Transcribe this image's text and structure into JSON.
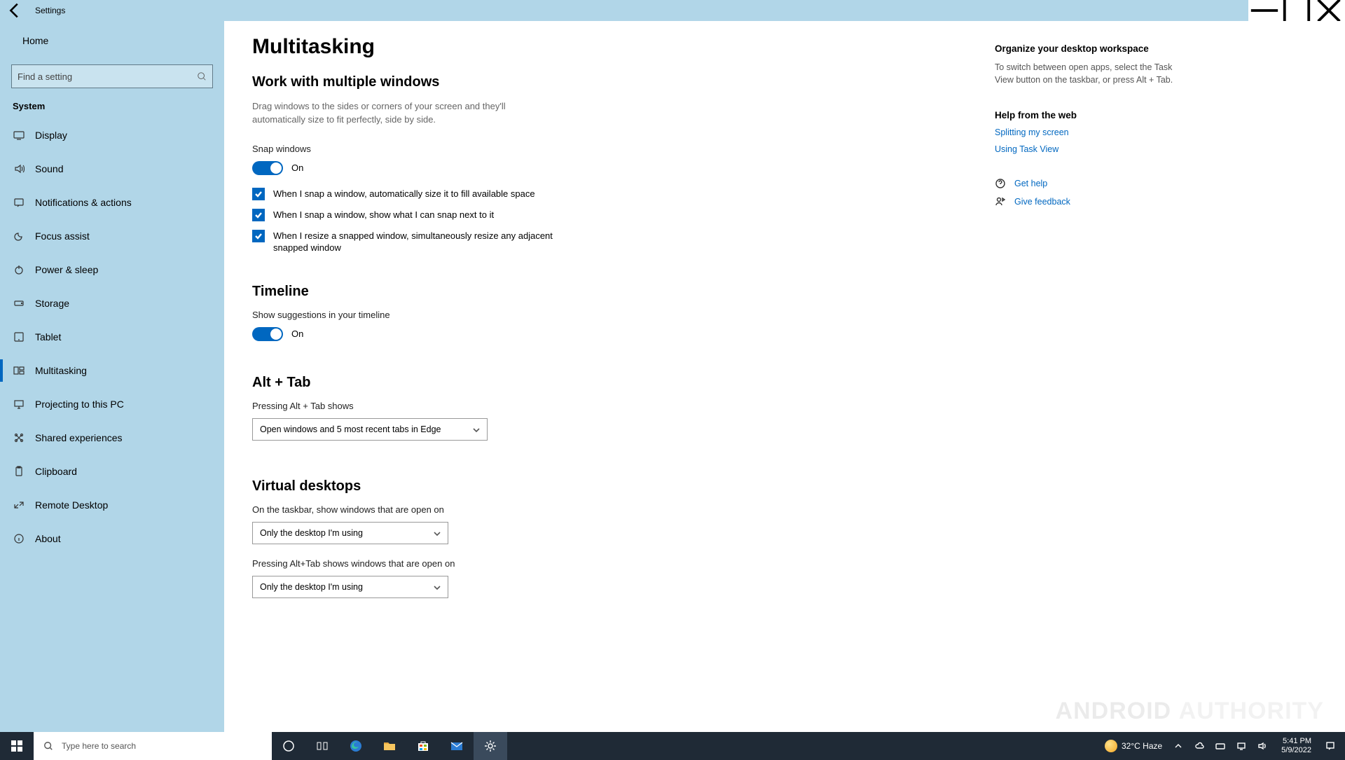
{
  "window": {
    "title": "Settings"
  },
  "sidebar": {
    "home": "Home",
    "search_placeholder": "Find a setting",
    "group": "System",
    "items": [
      {
        "label": "Display"
      },
      {
        "label": "Sound"
      },
      {
        "label": "Notifications & actions"
      },
      {
        "label": "Focus assist"
      },
      {
        "label": "Power & sleep"
      },
      {
        "label": "Storage"
      },
      {
        "label": "Tablet"
      },
      {
        "label": "Multitasking"
      },
      {
        "label": "Projecting to this PC"
      },
      {
        "label": "Shared experiences"
      },
      {
        "label": "Clipboard"
      },
      {
        "label": "Remote Desktop"
      },
      {
        "label": "About"
      }
    ]
  },
  "page": {
    "title": "Multitasking",
    "sec1_title": "Work with multiple windows",
    "sec1_desc": "Drag windows to the sides or corners of your screen and they'll automatically size to fit perfectly, side by side.",
    "snap_label": "Snap windows",
    "snap_state": "On",
    "checks": [
      "When I snap a window, automatically size it to fill available space",
      "When I snap a window, show what I can snap next to it",
      "When I resize a snapped window, simultaneously resize any adjacent snapped window"
    ],
    "sec2_title": "Timeline",
    "timeline_label": "Show suggestions in your timeline",
    "timeline_state": "On",
    "sec3_title": "Alt + Tab",
    "alttab_label": "Pressing Alt + Tab shows",
    "alttab_value": "Open windows and 5 most recent tabs in Edge",
    "sec4_title": "Virtual desktops",
    "vd1_label": "On the taskbar, show windows that are open on",
    "vd1_value": "Only the desktop I'm using",
    "vd2_label": "Pressing Alt+Tab shows windows that are open on",
    "vd2_value": "Only the desktop I'm using"
  },
  "side": {
    "h1": "Organize your desktop workspace",
    "p1": "To switch between open apps, select the Task View button on the taskbar, or press Alt + Tab.",
    "h2": "Help from the web",
    "link1": "Splitting my screen",
    "link2": "Using Task View",
    "help": "Get help",
    "feedback": "Give feedback"
  },
  "taskbar": {
    "search_placeholder": "Type here to search",
    "weather": "32°C  Haze",
    "time": "5:41 PM",
    "date": "5/9/2022"
  },
  "watermark": {
    "a": "ANDROID",
    "b": "AUTHORITY"
  }
}
